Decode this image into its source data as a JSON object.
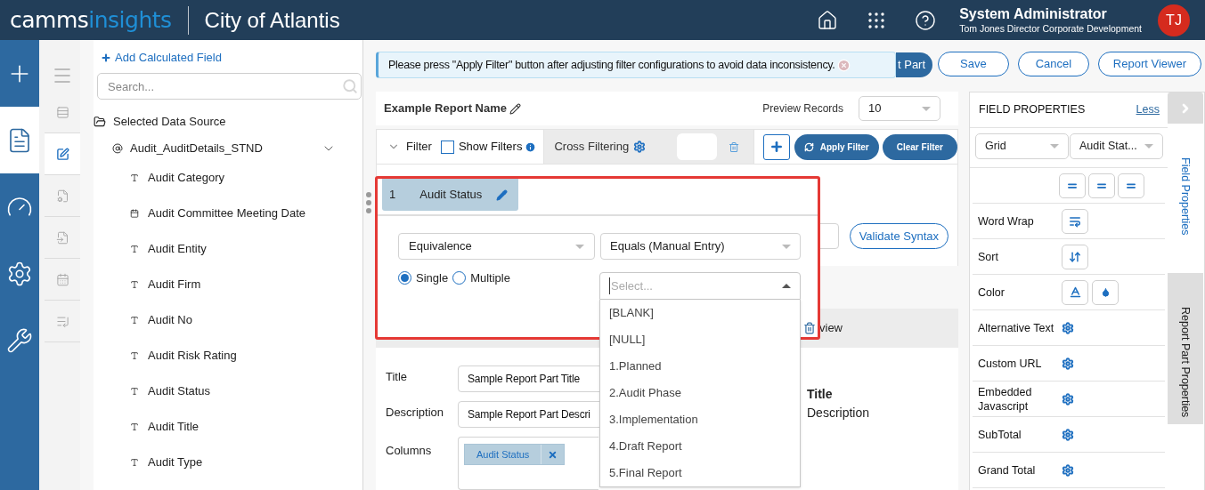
{
  "header": {
    "logo": [
      "camms",
      "insights"
    ],
    "org": "City of Atlantis",
    "user_name": "System Administrator",
    "user_role": "Tom Jones Director Corporate Development",
    "avatar": "TJ"
  },
  "main_rail": [
    {
      "kind": "add",
      "selected": false
    },
    {
      "kind": "document",
      "selected": true
    },
    {
      "kind": "gauge",
      "selected": false
    },
    {
      "kind": "gears",
      "selected": false
    },
    {
      "kind": "tools",
      "selected": false
    }
  ],
  "sub_rail": [
    {
      "kind": "menu",
      "selected": false
    },
    {
      "kind": "rows",
      "selected": false
    },
    {
      "kind": "edit",
      "selected": true
    },
    {
      "kind": "report",
      "selected": false
    },
    {
      "kind": "export",
      "selected": false
    },
    {
      "kind": "calendar",
      "selected": false
    },
    {
      "kind": "list",
      "selected": false
    }
  ],
  "data_source": {
    "add_field": "Add Calculated Field",
    "search": {
      "placeholder": "Search..."
    },
    "title": "Selected Data Source",
    "source": "Audit_AuditDetails_STND",
    "expanded": true,
    "fields": [
      {
        "name": "Audit Category",
        "kind": "text"
      },
      {
        "name": "Audit Committee Meeting Date",
        "kind": "date"
      },
      {
        "name": "Audit Entity",
        "kind": "text"
      },
      {
        "name": "Audit Firm",
        "kind": "text"
      },
      {
        "name": "Audit No",
        "kind": "text"
      },
      {
        "name": "Audit Risk Rating",
        "kind": "text"
      },
      {
        "name": "Audit Status",
        "kind": "text"
      },
      {
        "name": "Audit Title",
        "kind": "text"
      },
      {
        "name": "Audit Type",
        "kind": "text"
      }
    ]
  },
  "toolbar": {
    "notification": "Please press \"Apply Filter\" button after adjusting filter configurations to avoid data inconsistency.",
    "hidden_button": "t Part",
    "buttons": [
      "Save",
      "Cancel",
      "Report Viewer"
    ]
  },
  "report": {
    "name": "Example Report Name",
    "preview_label": "Preview Records",
    "preview_value": "10"
  },
  "filter_bar": {
    "label": "Filter",
    "expanded": false,
    "show_filters": {
      "label": "Show Filters",
      "checked": false
    },
    "cross_filtering": "Cross Filtering",
    "apply": "Apply Filter",
    "clear": "Clear Filter"
  },
  "filter_popup": {
    "number": "1",
    "field": "Audit Status",
    "operator_group": "Equivalence",
    "operator": "Equals (Manual Entry)",
    "modes": [
      {
        "label": "Single",
        "selected": true
      },
      {
        "label": "Multiple",
        "selected": false
      }
    ],
    "value": {
      "placeholder": "Select...",
      "expanded": true
    },
    "options": [
      "[BLANK]",
      "[NULL]",
      "1.Planned",
      "2.Audit Phase",
      "3.Implementation",
      "4.Draft Report",
      "5.Final Report"
    ]
  },
  "background": {
    "validate": "Validate Syntax",
    "section_tab": "view",
    "form": [
      {
        "label": "Title",
        "value": "Sample Report Part Title"
      },
      {
        "label": "Description",
        "value": "Sample Report Part Descri"
      }
    ],
    "columns_label": "Columns",
    "column_chip": "Audit Status",
    "preview_title": "Title",
    "preview_description": "Description"
  },
  "field_properties": {
    "title": "FIELD PROPERTIES",
    "less": "Less",
    "selects": [
      "Grid",
      "Audit Stat..."
    ],
    "rows": [
      {
        "kind": "align"
      },
      {
        "kind": "wrap",
        "label": "Word Wrap"
      },
      {
        "kind": "sort",
        "label": "Sort"
      },
      {
        "kind": "color",
        "label": "Color"
      },
      {
        "kind": "gear",
        "label": "Alternative Text"
      },
      {
        "kind": "gear",
        "label": "Custom URL"
      },
      {
        "kind": "gear",
        "label": "Embedded Javascript"
      },
      {
        "kind": "gear",
        "label": "SubTotal"
      },
      {
        "kind": "gear",
        "label": "Grand Total"
      }
    ],
    "tabs": [
      {
        "label": "Field Properties",
        "selected": true
      },
      {
        "label": "Report Part Properties",
        "selected": false
      }
    ]
  }
}
